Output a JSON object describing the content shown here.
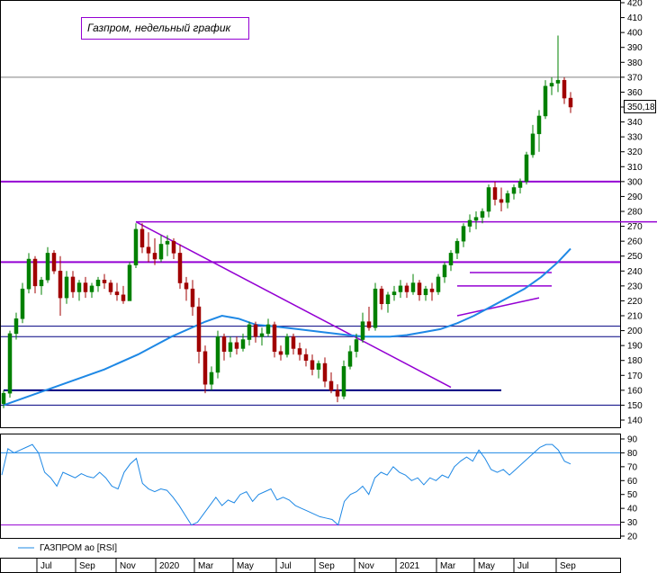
{
  "chart_data": [
    {
      "type": "candlestick",
      "title": "Газпром, недельный график",
      "ylim": [
        140,
        420
      ],
      "y_ticks": [
        140,
        150,
        160,
        170,
        180,
        190,
        200,
        210,
        220,
        230,
        240,
        250,
        260,
        270,
        280,
        290,
        300,
        310,
        320,
        330,
        340,
        350,
        360,
        370,
        380,
        390,
        400,
        410,
        420
      ],
      "last_price": "350,18",
      "candles": [
        [
          151,
          160,
          148,
          158
        ],
        [
          158,
          200,
          155,
          198
        ],
        [
          198,
          212,
          194,
          208
        ],
        [
          208,
          232,
          205,
          228
        ],
        [
          228,
          252,
          225,
          248
        ],
        [
          248,
          250,
          225,
          230
        ],
        [
          230,
          236,
          224,
          234
        ],
        [
          234,
          256,
          232,
          252
        ],
        [
          252,
          254,
          238,
          240
        ],
        [
          240,
          250,
          210,
          222
        ],
        [
          222,
          240,
          218,
          236
        ],
        [
          236,
          240,
          222,
          226
        ],
        [
          226,
          234,
          220,
          232
        ],
        [
          232,
          236,
          222,
          226
        ],
        [
          226,
          232,
          222,
          230
        ],
        [
          230,
          236,
          226,
          234
        ],
        [
          234,
          238,
          228,
          232
        ],
        [
          232,
          234,
          224,
          226
        ],
        [
          226,
          232,
          220,
          224
        ],
        [
          224,
          230,
          218,
          220
        ],
        [
          220,
          246,
          220,
          244
        ],
        [
          244,
          272,
          242,
          268
        ],
        [
          268,
          272,
          252,
          256
        ],
        [
          256,
          266,
          246,
          252
        ],
        [
          252,
          262,
          244,
          248
        ],
        [
          248,
          264,
          246,
          258
        ],
        [
          258,
          264,
          250,
          260
        ],
        [
          260,
          262,
          248,
          252
        ],
        [
          252,
          258,
          228,
          232
        ],
        [
          232,
          236,
          220,
          228
        ],
        [
          228,
          234,
          210,
          216
        ],
        [
          216,
          222,
          178,
          186
        ],
        [
          186,
          190,
          158,
          164
        ],
        [
          164,
          176,
          160,
          172
        ],
        [
          172,
          200,
          168,
          196
        ],
        [
          196,
          198,
          180,
          186
        ],
        [
          186,
          196,
          182,
          192
        ],
        [
          192,
          196,
          184,
          188
        ],
        [
          188,
          198,
          186,
          194
        ],
        [
          194,
          206,
          190,
          204
        ],
        [
          204,
          206,
          192,
          196
        ],
        [
          196,
          202,
          190,
          198
        ],
        [
          198,
          208,
          196,
          204
        ],
        [
          204,
          206,
          182,
          186
        ],
        [
          186,
          190,
          180,
          184
        ],
        [
          184,
          198,
          182,
          196
        ],
        [
          196,
          198,
          184,
          188
        ],
        [
          188,
          192,
          180,
          184
        ],
        [
          184,
          188,
          176,
          180
        ],
        [
          180,
          184,
          170,
          174
        ],
        [
          174,
          180,
          168,
          178
        ],
        [
          178,
          182,
          162,
          166
        ],
        [
          166,
          172,
          158,
          160
        ],
        [
          160,
          164,
          152,
          156
        ],
        [
          156,
          180,
          154,
          176
        ],
        [
          176,
          190,
          174,
          186
        ],
        [
          186,
          198,
          182,
          194
        ],
        [
          194,
          212,
          192,
          206
        ],
        [
          206,
          216,
          200,
          202
        ],
        [
          202,
          232,
          200,
          228
        ],
        [
          228,
          230,
          214,
          218
        ],
        [
          218,
          226,
          212,
          224
        ],
        [
          224,
          230,
          220,
          226
        ],
        [
          226,
          234,
          222,
          230
        ],
        [
          230,
          232,
          222,
          226
        ],
        [
          226,
          238,
          224,
          232
        ],
        [
          232,
          234,
          220,
          224
        ],
        [
          224,
          230,
          220,
          228
        ],
        [
          228,
          232,
          220,
          226
        ],
        [
          226,
          238,
          224,
          236
        ],
        [
          236,
          246,
          232,
          244
        ],
        [
          244,
          254,
          240,
          252
        ],
        [
          252,
          262,
          248,
          260
        ],
        [
          260,
          272,
          256,
          270
        ],
        [
          270,
          278,
          266,
          274
        ],
        [
          274,
          280,
          268,
          276
        ],
        [
          276,
          282,
          272,
          280
        ],
        [
          280,
          298,
          276,
          296
        ],
        [
          296,
          300,
          284,
          288
        ],
        [
          288,
          296,
          280,
          286
        ],
        [
          286,
          294,
          282,
          292
        ],
        [
          292,
          298,
          288,
          296
        ],
        [
          296,
          302,
          292,
          300
        ],
        [
          300,
          320,
          298,
          318
        ],
        [
          318,
          338,
          316,
          332
        ],
        [
          332,
          348,
          320,
          344
        ],
        [
          344,
          368,
          342,
          364
        ],
        [
          364,
          370,
          358,
          366
        ],
        [
          366,
          398,
          360,
          368
        ],
        [
          368,
          370,
          352,
          356
        ],
        [
          356,
          360,
          346,
          350
        ]
      ],
      "x_labels": [
        "Jul",
        "Sep",
        "Nov",
        "2020",
        "Mar",
        "May",
        "Jul",
        "Sep",
        "Nov",
        "2021",
        "Mar",
        "May",
        "Jul",
        "Sep"
      ],
      "ma_line": [
        [
          0,
          150
        ],
        [
          8,
          158
        ],
        [
          16,
          166
        ],
        [
          24,
          174
        ],
        [
          32,
          184
        ],
        [
          40,
          196
        ],
        [
          48,
          206
        ],
        [
          52,
          210
        ],
        [
          56,
          208
        ],
        [
          60,
          204
        ],
        [
          64,
          203
        ],
        [
          70,
          201
        ],
        [
          76,
          199
        ],
        [
          82,
          197
        ],
        [
          86,
          196
        ],
        [
          88,
          196
        ],
        [
          92,
          196
        ],
        [
          96,
          197
        ],
        [
          100,
          199
        ],
        [
          104,
          201
        ],
        [
          108,
          205
        ],
        [
          112,
          210
        ],
        [
          116,
          216
        ],
        [
          120,
          222
        ],
        [
          124,
          228
        ],
        [
          128,
          236
        ],
        [
          132,
          246
        ],
        [
          135,
          255
        ]
      ],
      "hlines": [
        {
          "y": 370,
          "color": "#808080"
        },
        {
          "y": 300,
          "color": "#9400d3"
        },
        {
          "y": 246,
          "color": "#9400d3"
        },
        {
          "y": 203,
          "color": "#000080"
        },
        {
          "y": 196,
          "color": "#000080"
        },
        {
          "y": 150,
          "color": "#000080"
        }
      ],
      "segments": [
        {
          "x1": 21,
          "y1": 273,
          "x2": 104,
          "y2": 273,
          "color": "#9400d3"
        },
        {
          "x1": 21,
          "y1": 273,
          "x2": 71,
          "y2": 162,
          "color": "#9400d3"
        },
        {
          "x1": 0,
          "y1": 160,
          "x2": 79,
          "y2": 160,
          "color": "#000080"
        },
        {
          "x1": 72,
          "y1": 230,
          "x2": 87,
          "y2": 230,
          "color": "#9400d3"
        },
        {
          "x1": 74,
          "y1": 239,
          "x2": 87,
          "y2": 239,
          "color": "#9400d3"
        },
        {
          "x1": 72,
          "y1": 210,
          "x2": 85,
          "y2": 222,
          "color": "#9400d3"
        }
      ]
    },
    {
      "type": "line",
      "legend": "ГАЗПРОМ ао [RSI]",
      "ylim": [
        20,
        90
      ],
      "y_ticks": [
        20,
        30,
        40,
        50,
        60,
        70,
        80,
        90
      ],
      "levels": [
        80,
        28
      ],
      "x_labels": [
        "Jul",
        "Sep",
        "Nov",
        "2020",
        "Mar",
        "May",
        "Jul",
        "Sep",
        "Nov",
        "2021",
        "Mar",
        "May",
        "Jul",
        "Sep"
      ],
      "values": [
        64,
        83,
        80,
        82,
        84,
        86,
        80,
        66,
        62,
        56,
        66,
        64,
        62,
        65,
        63,
        62,
        66,
        62,
        56,
        54,
        66,
        72,
        76,
        58,
        54,
        52,
        54,
        53,
        48,
        42,
        35,
        28,
        30,
        36,
        42,
        48,
        42,
        46,
        44,
        50,
        52,
        45,
        50,
        52,
        54,
        46,
        48,
        46,
        42,
        40,
        38,
        36,
        34,
        33,
        32,
        28,
        45,
        50,
        52,
        56,
        50,
        62,
        66,
        64,
        70,
        66,
        64,
        60,
        62,
        57,
        62,
        60,
        64,
        62,
        70,
        74,
        77,
        74,
        82,
        76,
        68,
        66,
        68,
        64,
        68,
        72,
        76,
        80,
        84,
        86,
        86,
        82,
        74,
        72
      ]
    }
  ]
}
